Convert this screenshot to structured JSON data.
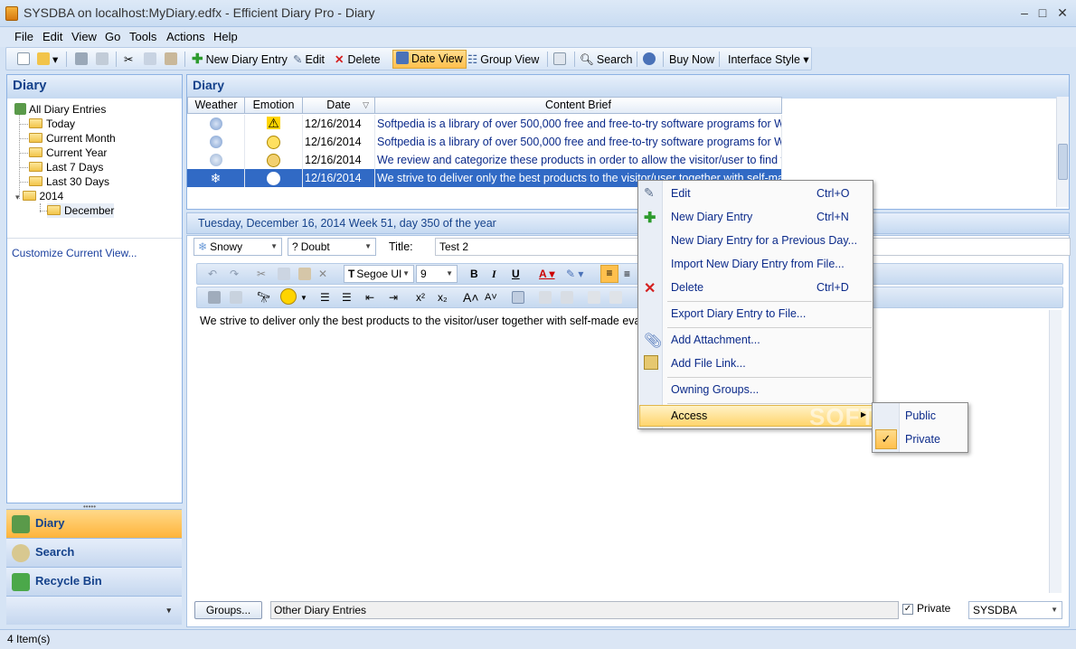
{
  "window": {
    "title": "SYSDBA on localhost:MyDiary.edfx - Efficient Diary Pro - Diary",
    "min": "–",
    "max": "□",
    "close": "✕"
  },
  "menu": [
    "File",
    "Edit",
    "View",
    "Go",
    "Tools",
    "Actions",
    "Help"
  ],
  "toolbar": {
    "new_entry": "New Diary Entry",
    "edit": "Edit",
    "delete": "Delete",
    "date_view": "Date View",
    "group_view": "Group View",
    "search": "Search",
    "buy_now": "Buy Now",
    "interface_style": "Interface Style"
  },
  "left_panel": {
    "title": "Diary",
    "tree": {
      "root": "All Diary Entries",
      "items": [
        "Today",
        "Current Month",
        "Current Year",
        "Last 7 Days",
        "Last 30 Days",
        "2014",
        "December"
      ]
    },
    "customize": "Customize Current View..."
  },
  "nav": {
    "diary": "Diary",
    "search": "Search",
    "recycle_bin": "Recycle Bin"
  },
  "main": {
    "title": "Diary",
    "columns": [
      "Weather",
      "Emotion",
      "Date",
      "Content Brief"
    ],
    "rows": [
      {
        "date": "12/16/2014",
        "brief": "Softpedia is a library of over 500,000 free and free-to-try software programs for Windo"
      },
      {
        "date": "12/16/2014",
        "brief": "Softpedia is a library of over 500,000 free and free-to-try software programs for Windo"
      },
      {
        "date": "12/16/2014",
        "brief": "We review and categorize these products in order to allow the visitor/user to find the"
      },
      {
        "date": "12/16/2014",
        "brief": "We strive to deliver only the best products to the visitor/user together with self-made"
      }
    ]
  },
  "entry": {
    "date_header": "Tuesday, December 16, 2014  Week 51, day 350 of the year",
    "weather": "Snowy",
    "emotion": "Doubt",
    "title_label": "Title:",
    "title_value": "Test 2",
    "font": "Segoe UI",
    "size": "9",
    "body": "We strive to deliver only the best products to the visitor/user together with self-made evalua"
  },
  "footer": {
    "groups_btn": "Groups...",
    "groups_value": "Other Diary Entries",
    "private_label": "Private",
    "user": "SYSDBA"
  },
  "context_menu": {
    "items": [
      {
        "label": "Edit",
        "shortcut": "Ctrl+O"
      },
      {
        "label": "New Diary Entry",
        "shortcut": "Ctrl+N"
      },
      {
        "label": "New Diary Entry for a Previous Day...",
        "shortcut": ""
      },
      {
        "label": "Import New Diary Entry from File...",
        "shortcut": ""
      },
      {
        "label": "Delete",
        "shortcut": "Ctrl+D"
      },
      {
        "label": "Export Diary Entry to File...",
        "shortcut": ""
      },
      {
        "label": "Add Attachment...",
        "shortcut": ""
      },
      {
        "label": "Add File Link...",
        "shortcut": ""
      },
      {
        "label": "Owning Groups...",
        "shortcut": ""
      },
      {
        "label": "Access",
        "shortcut": ""
      }
    ],
    "submenu": [
      "Public",
      "Private"
    ]
  },
  "status": "4 Item(s)",
  "watermark": "SOFTPEDIA"
}
